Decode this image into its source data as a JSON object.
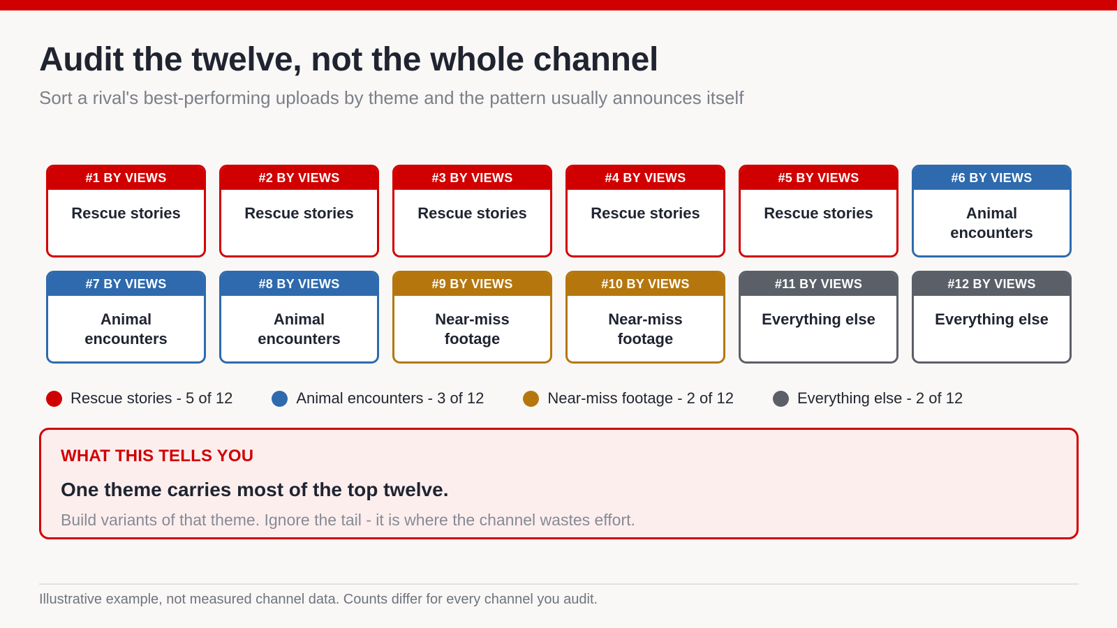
{
  "title": "Audit the twelve, not the whole channel",
  "subtitle": "Sort a rival's best-performing uploads by theme and the pattern usually announces itself",
  "themes": {
    "rescue": {
      "name": "Rescue stories",
      "color": "#d10000"
    },
    "animal": {
      "name": "Animal encounters",
      "color": "#2e6aad"
    },
    "nearmiss": {
      "name": "Near-miss footage",
      "color": "#b5770d"
    },
    "other": {
      "name": "Everything else",
      "color": "#5b5f68"
    }
  },
  "cards": [
    {
      "rank": "#1 BY VIEWS",
      "label": "Rescue stories",
      "theme": "rescue"
    },
    {
      "rank": "#2 BY VIEWS",
      "label": "Rescue stories",
      "theme": "rescue"
    },
    {
      "rank": "#3 BY VIEWS",
      "label": "Rescue stories",
      "theme": "rescue"
    },
    {
      "rank": "#4 BY VIEWS",
      "label": "Rescue stories",
      "theme": "rescue"
    },
    {
      "rank": "#5 BY VIEWS",
      "label": "Rescue stories",
      "theme": "rescue"
    },
    {
      "rank": "#6 BY VIEWS",
      "label": "Animal encounters",
      "theme": "animal"
    },
    {
      "rank": "#7 BY VIEWS",
      "label": "Animal encounters",
      "theme": "animal"
    },
    {
      "rank": "#8 BY VIEWS",
      "label": "Animal encounters",
      "theme": "animal"
    },
    {
      "rank": "#9 BY VIEWS",
      "label": "Near-miss footage",
      "theme": "nearmiss"
    },
    {
      "rank": "#10 BY VIEWS",
      "label": "Near-miss footage",
      "theme": "nearmiss"
    },
    {
      "rank": "#11 BY VIEWS",
      "label": "Everything else",
      "theme": "other"
    },
    {
      "rank": "#12 BY VIEWS",
      "label": "Everything else",
      "theme": "other"
    }
  ],
  "legend": [
    {
      "text": "Rescue stories - 5 of 12",
      "theme": "rescue"
    },
    {
      "text": "Animal encounters - 3 of 12",
      "theme": "animal"
    },
    {
      "text": "Near-miss footage - 2 of 12",
      "theme": "nearmiss"
    },
    {
      "text": "Everything else - 2 of 12",
      "theme": "other"
    }
  ],
  "insight": {
    "kicker": "WHAT THIS TELLS YOU",
    "headline": "One theme carries most of the top twelve.",
    "body": "Build variants of that theme. Ignore the tail - it is where the channel wastes effort."
  },
  "footnote": "Illustrative example, not measured channel data. Counts differ for every channel you audit."
}
